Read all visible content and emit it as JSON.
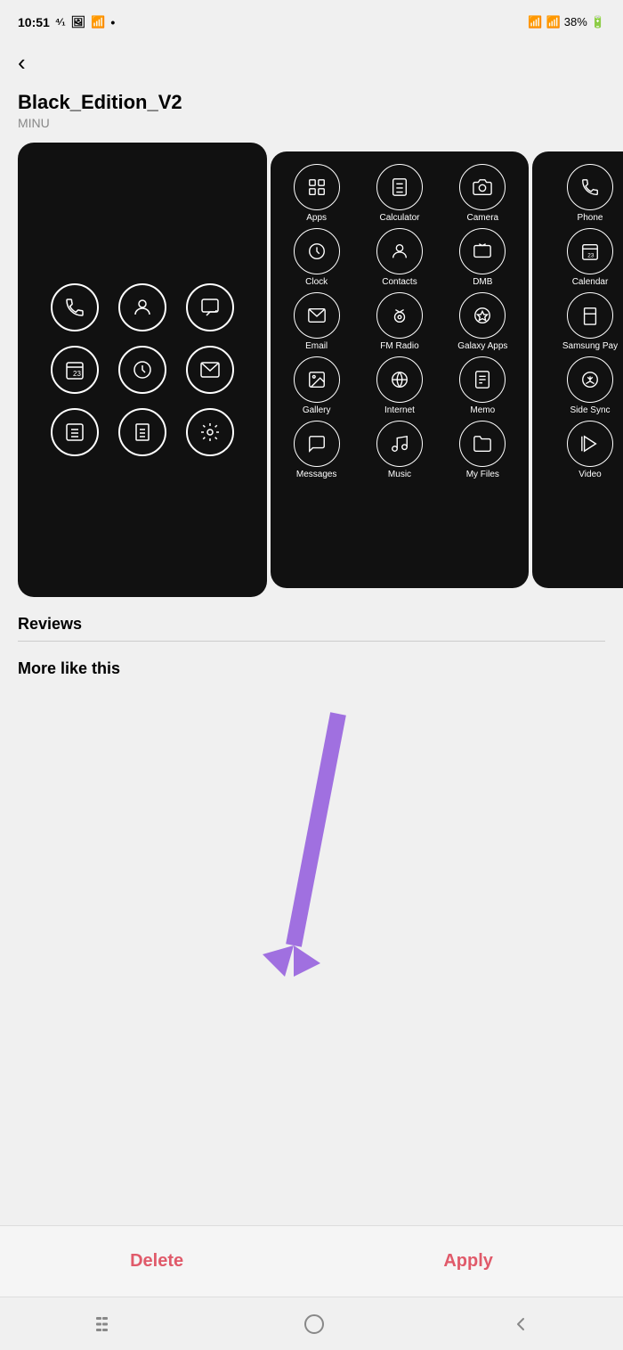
{
  "statusBar": {
    "time": "10:51",
    "battery": "38%"
  },
  "header": {
    "backLabel": "‹",
    "title": "Black_Edition_V2",
    "subtitle": "MINU"
  },
  "preview": {
    "mainIcons": [
      [
        "phone",
        "person",
        "chat"
      ],
      [
        "calendar",
        "clock",
        "email"
      ],
      [
        "calculator",
        "clipboard",
        "settings"
      ]
    ],
    "gridIcons": [
      [
        {
          "label": "Apps",
          "icon": "⊞"
        },
        {
          "label": "Calculator",
          "icon": "⊟"
        },
        {
          "label": "Camera",
          "icon": "⊙"
        }
      ],
      [
        {
          "label": "Clock",
          "icon": "⊚"
        },
        {
          "label": "Contacts",
          "icon": "⊛"
        },
        {
          "label": "DMB",
          "icon": "⊠"
        }
      ],
      [
        {
          "label": "Email",
          "icon": "✉"
        },
        {
          "label": "FM Radio",
          "icon": "⊜"
        },
        {
          "label": "Galaxy Apps",
          "icon": "⊝"
        }
      ],
      [
        {
          "label": "Gallery",
          "icon": "⊡"
        },
        {
          "label": "Internet",
          "icon": "⊕"
        },
        {
          "label": "Memo",
          "icon": "⊞"
        }
      ],
      [
        {
          "label": "Messages",
          "icon": "⊟"
        },
        {
          "label": "Music",
          "icon": "♫"
        },
        {
          "label": "My Files",
          "icon": "⊡"
        }
      ]
    ],
    "partialIcons": [
      {
        "label": "Phone",
        "icon": "✆"
      },
      {
        "label": "Calendar",
        "icon": "⊟"
      },
      {
        "label": "Samsung Pay",
        "icon": "⊠"
      },
      {
        "label": "Side Sync",
        "icon": "⊙"
      },
      {
        "label": "Video",
        "icon": "⊜"
      }
    ]
  },
  "sections": {
    "reviews": "Reviews",
    "moreLikeThis": "More like this"
  },
  "actions": {
    "delete": "Delete",
    "apply": "Apply"
  },
  "nav": {
    "menu": "|||",
    "home": "○",
    "back": "‹"
  },
  "colors": {
    "actionRed": "#e05a6a",
    "arrowPurple": "#a070e0"
  }
}
